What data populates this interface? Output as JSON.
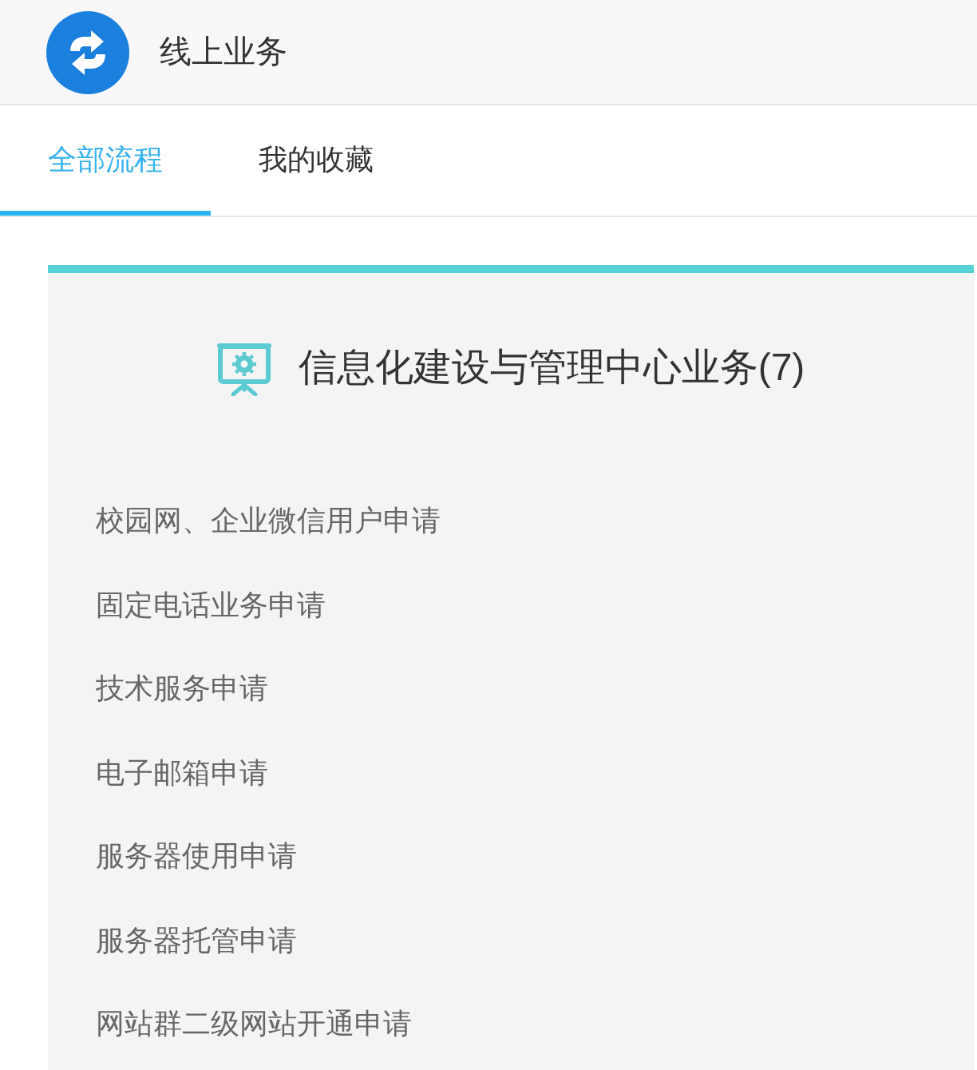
{
  "header": {
    "title": "线上业务"
  },
  "tabs": [
    {
      "label": "全部流程",
      "selected": true
    },
    {
      "label": "我的收藏",
      "selected": false
    }
  ],
  "category": {
    "title": "信息化建设与管理中心业务(7)",
    "items": [
      "校园网、企业微信用户申请",
      "固定电话业务申请",
      "技术服务申请",
      "电子邮箱申请",
      "服务器使用申请",
      "服务器托管申请",
      "网站群二级网站开通申请"
    ]
  }
}
